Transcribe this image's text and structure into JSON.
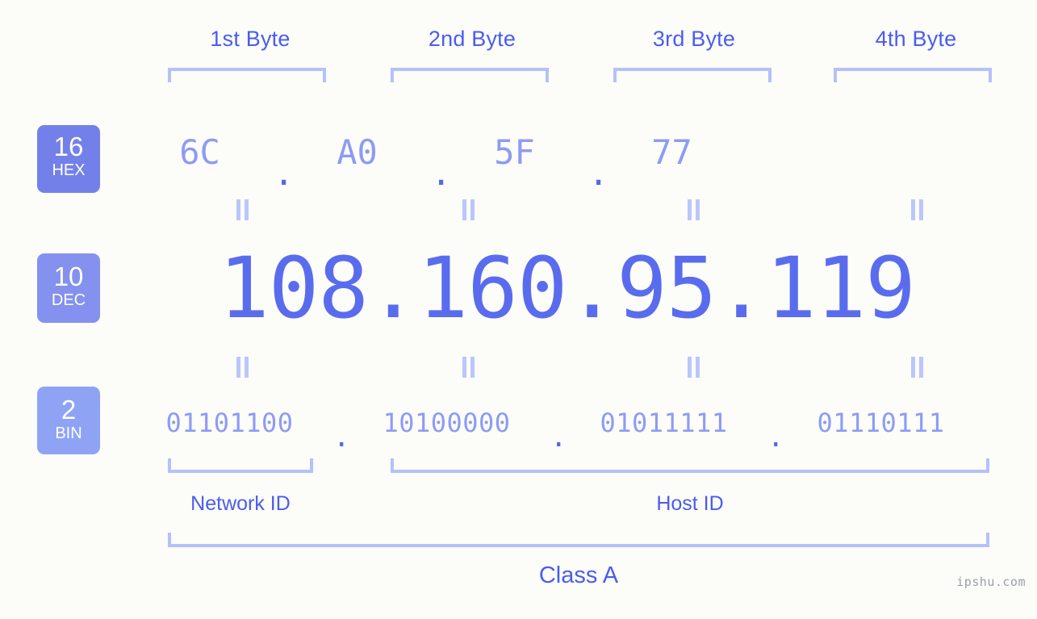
{
  "watermark": "ipshu.com",
  "colors": {
    "background": "#fcfdf9",
    "accent_strong": "#4a5cf0",
    "accent_mid": "#5a6cee",
    "accent_light": "#8e9bf4",
    "bracket": "#b6c0fb",
    "badge_hex": "#7480ea",
    "badge_dec": "#8491ee",
    "badge_bin": "#8fa3f5"
  },
  "byte_headers": [
    {
      "label": "1st Byte"
    },
    {
      "label": "2nd Byte"
    },
    {
      "label": "3rd Byte"
    },
    {
      "label": "4th Byte"
    }
  ],
  "bases": {
    "hex": {
      "number": "16",
      "name": "HEX"
    },
    "dec": {
      "number": "10",
      "name": "DEC"
    },
    "bin": {
      "number": "2",
      "name": "BIN"
    }
  },
  "separator": ".",
  "rows": {
    "hex": {
      "values": [
        "6C",
        "A0",
        "5F",
        "77"
      ]
    },
    "dec": {
      "values": [
        "108",
        "160",
        "95",
        "119"
      ]
    },
    "bin": {
      "values": [
        "01101100",
        "10100000",
        "01011111",
        "01110111"
      ]
    }
  },
  "address": {
    "dec_full": "108.160.95.119",
    "hex_full": "6C.A0.5F.77",
    "bin_full": "01101100.10100000.01011111.01110111"
  },
  "segments": {
    "network_id": "Network ID",
    "host_id": "Host ID",
    "class": "Class A"
  }
}
